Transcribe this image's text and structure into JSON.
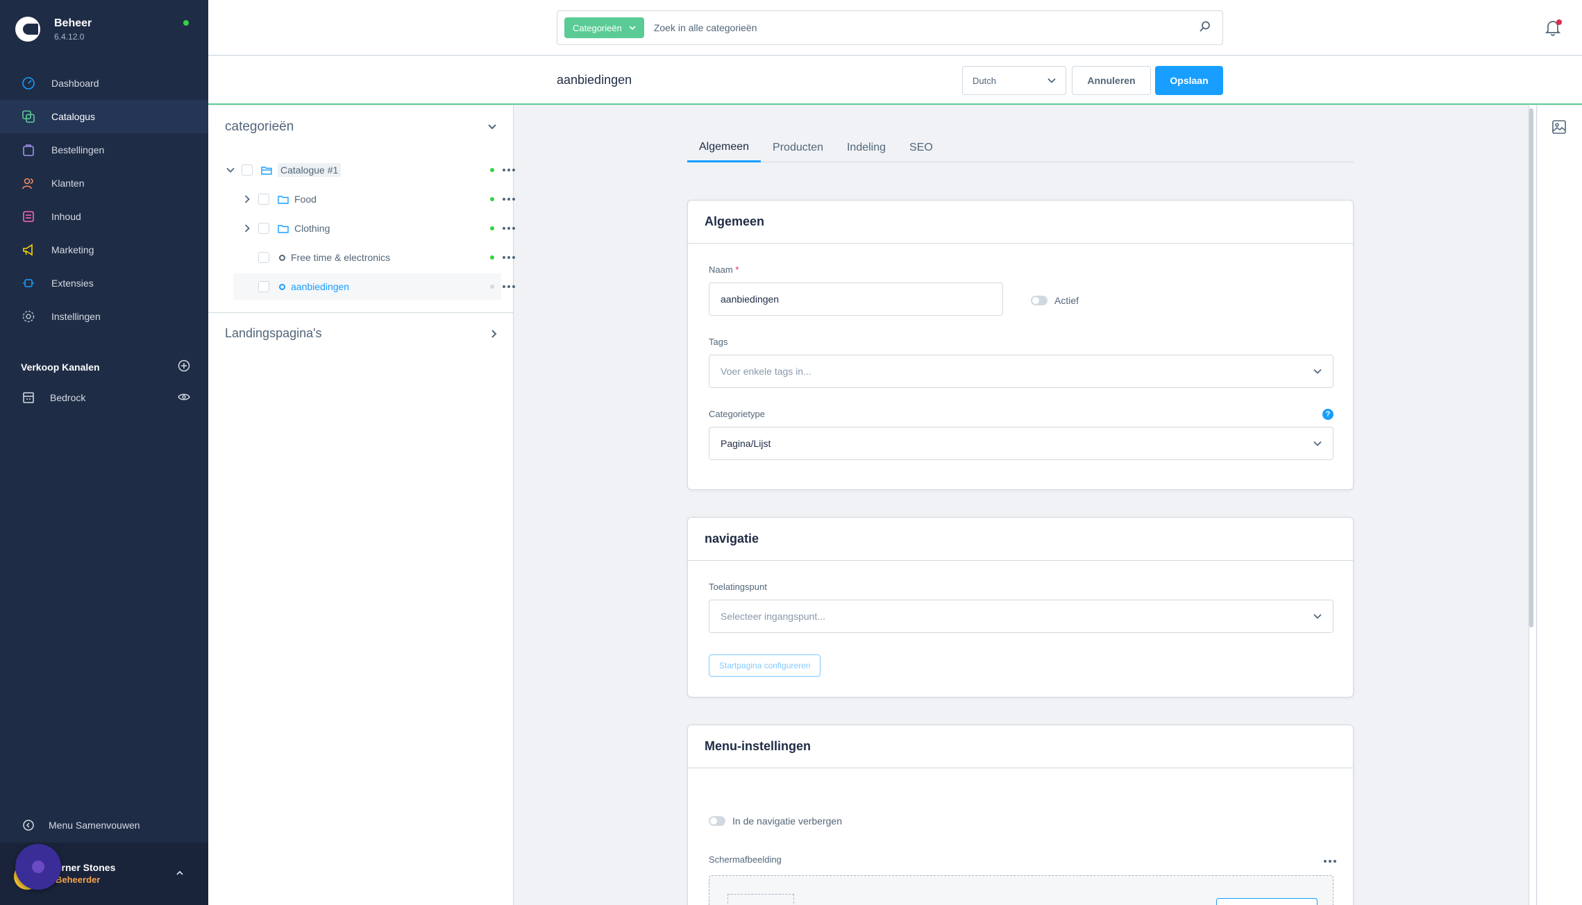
{
  "app": {
    "title": "Beheer",
    "version": "6.4.12.0"
  },
  "sidebar": {
    "items": [
      {
        "label": "Dashboard",
        "icon": "dashboard-icon"
      },
      {
        "label": "Catalogus",
        "icon": "catalog-icon"
      },
      {
        "label": "Bestellingen",
        "icon": "orders-icon"
      },
      {
        "label": "Klanten",
        "icon": "customers-icon"
      },
      {
        "label": "Inhoud",
        "icon": "content-icon"
      },
      {
        "label": "Marketing",
        "icon": "marketing-icon"
      },
      {
        "label": "Extensies",
        "icon": "extensions-icon"
      },
      {
        "label": "Instellingen",
        "icon": "settings-icon"
      }
    ],
    "sales_channels_title": "Verkoop Kanalen",
    "sales_channel": "Bedrock",
    "collapse_label": "Menu Samenvouwen",
    "user": {
      "name": "orner Stones",
      "role": "Beheerder"
    }
  },
  "search": {
    "type_label": "Categorieën",
    "placeholder": "Zoek in alle categorieën"
  },
  "smartbar": {
    "title": "aanbiedingen",
    "language": "Dutch",
    "cancel_label": "Annuleren",
    "save_label": "Opslaan"
  },
  "tree": {
    "title": "categorieën",
    "root": "Catalogue #1",
    "items": [
      "Food",
      "Clothing",
      "Free time & electronics",
      "aanbiedingen"
    ],
    "landing_pages": "Landingspagina's"
  },
  "tabs": [
    "Algemeen",
    "Producten",
    "Indeling",
    "SEO"
  ],
  "general": {
    "title": "Algemeen",
    "name_label": "Naam",
    "name_required": "*",
    "name_value": "aanbiedingen",
    "active_label": "Actief",
    "tags_label": "Tags",
    "tags_placeholder": "Voer enkele tags in...",
    "type_label": "Categorietype",
    "type_value": "Pagina/Lijst",
    "help_glyph": "?"
  },
  "navigation": {
    "title": "navigatie",
    "entry_label": "Toelatingspunt",
    "entry_placeholder": "Selecteer ingangspunt...",
    "configure_label": "Startpagina configureren"
  },
  "menu": {
    "title": "Menu-instellingen",
    "hide_label": "In de navigatie verbergen",
    "image_label": "Schermafbeelding"
  },
  "colors": {
    "sidebar": "#1f2c45",
    "accent": "#189eff",
    "green": "#5bcb96",
    "status": "#37d046"
  }
}
